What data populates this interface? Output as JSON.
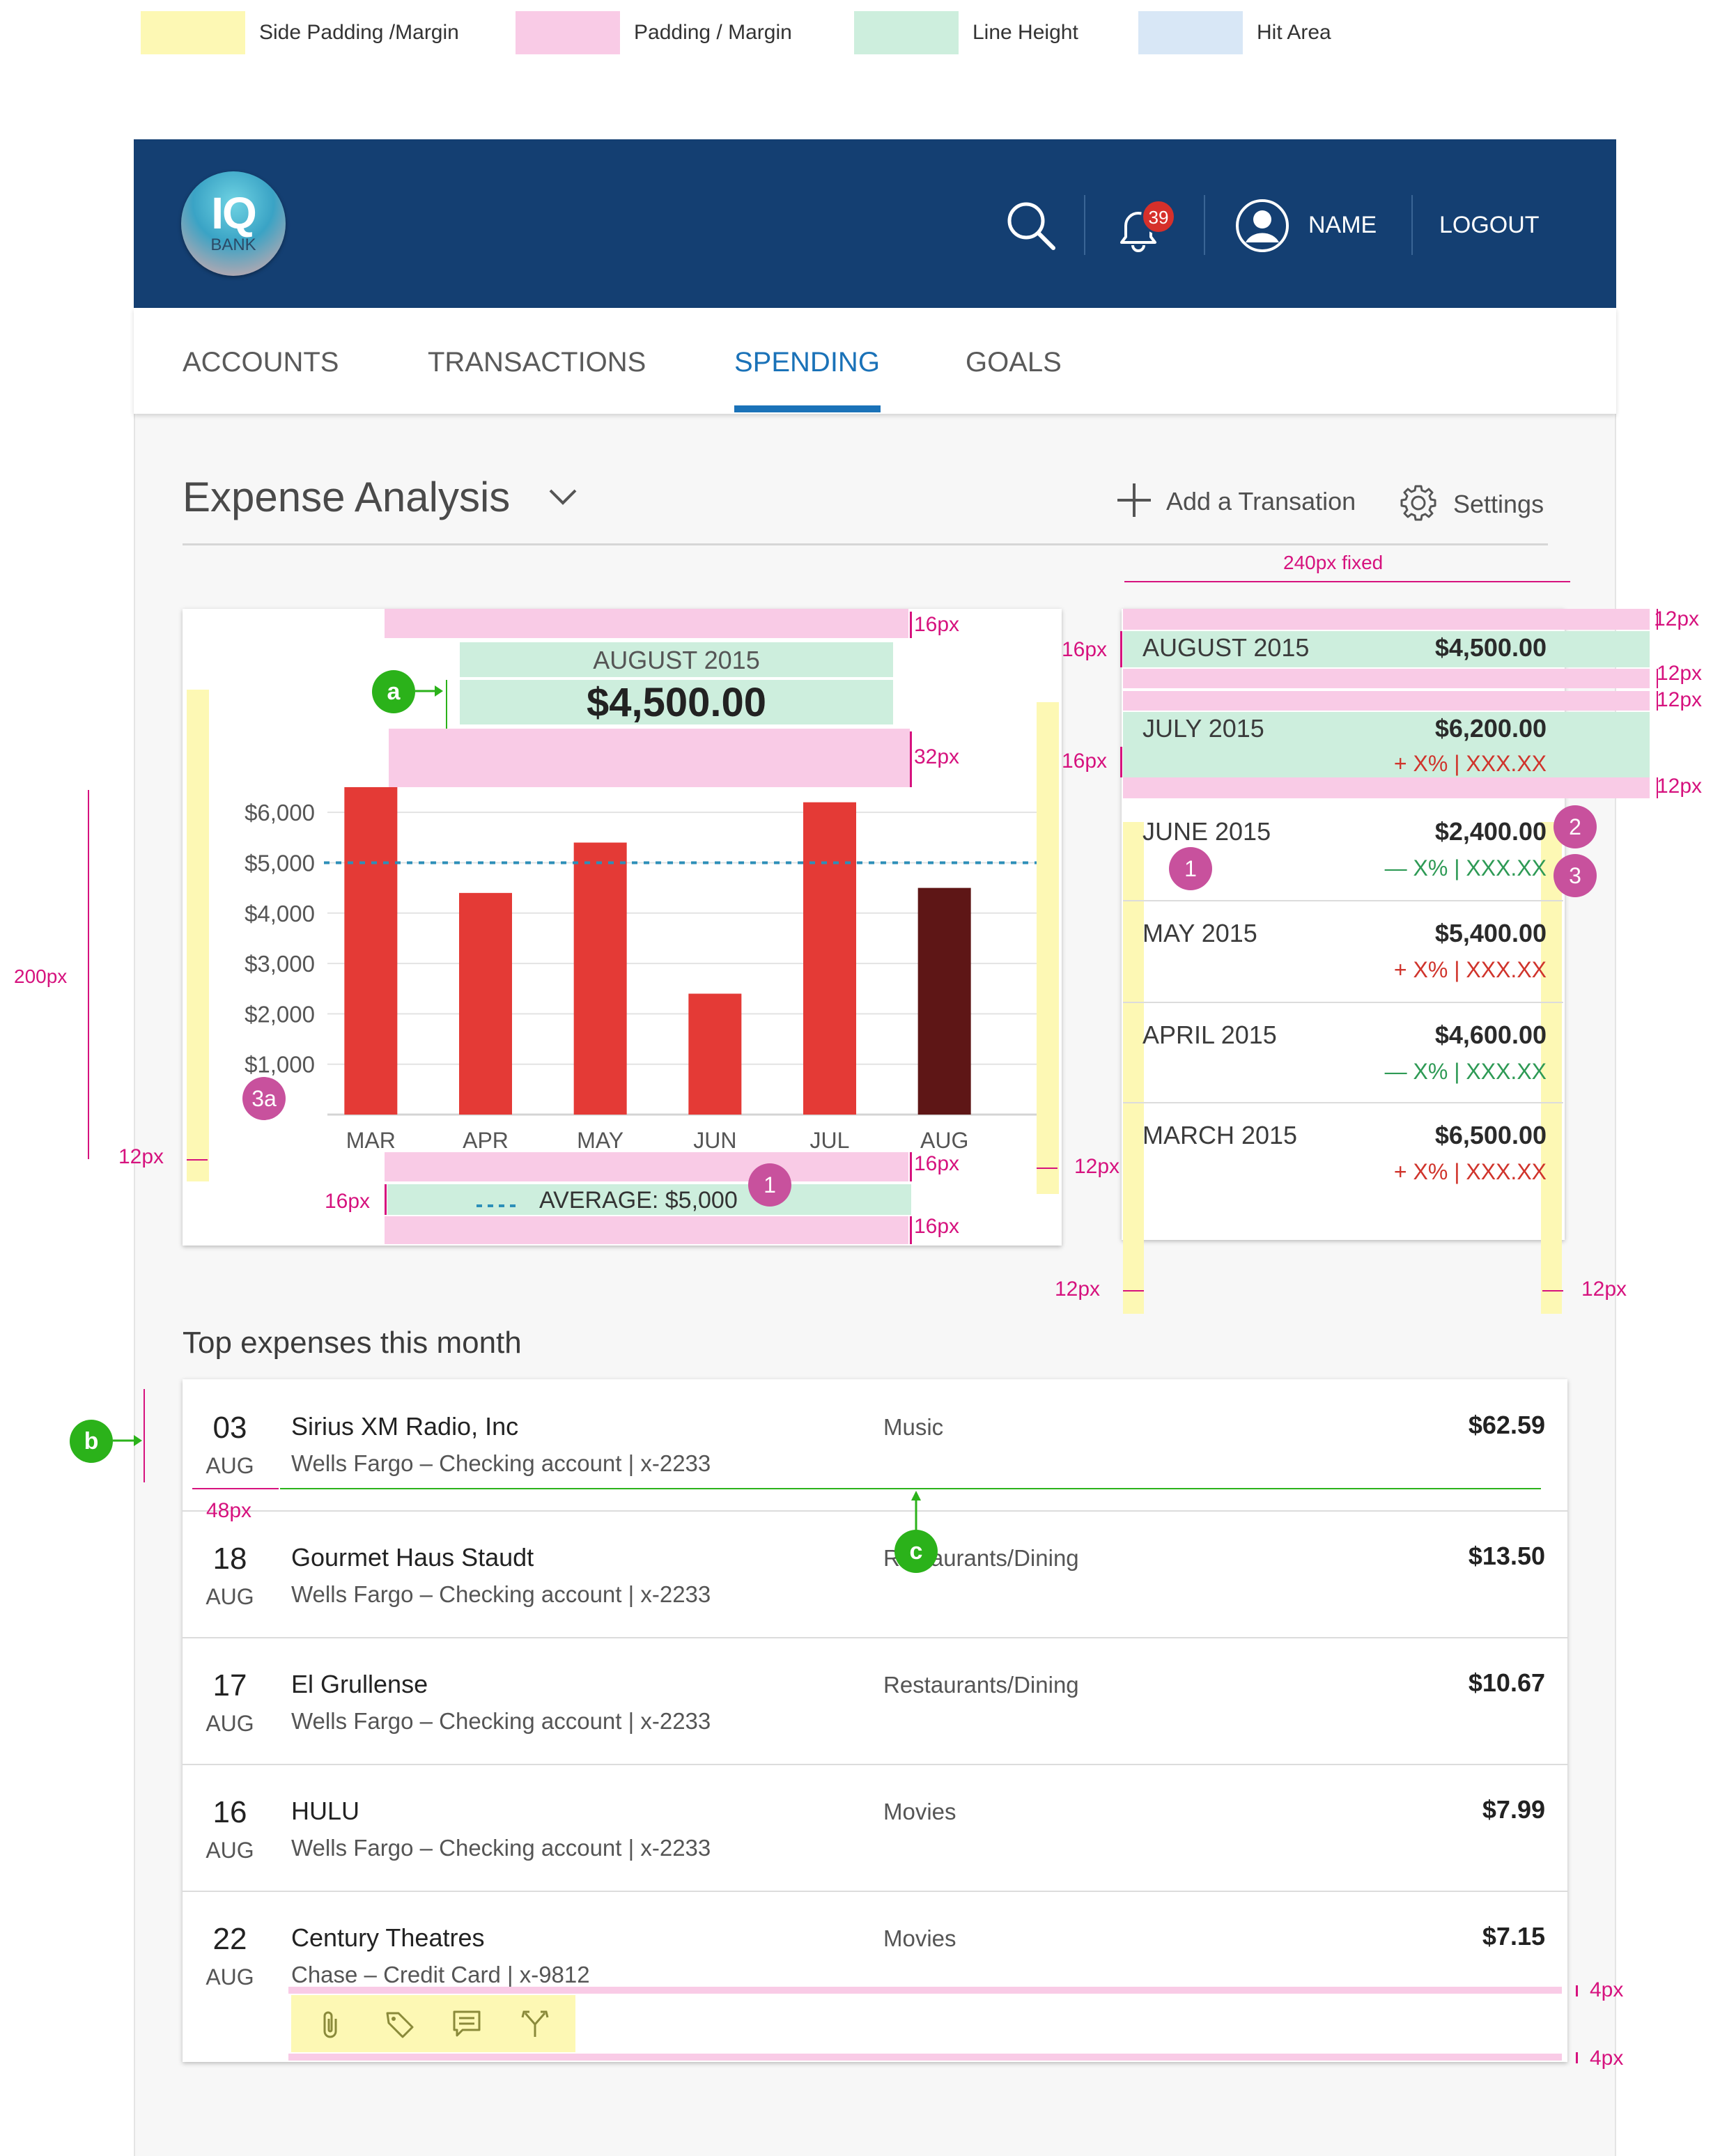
{
  "legend": [
    {
      "label": "Side Padding /Margin",
      "color": "#fdf8b4"
    },
    {
      "label": "Padding / Margin",
      "color": "#f9cbe6"
    },
    {
      "label": "Line Height",
      "color": "#cdeedd"
    },
    {
      "label": "Hit Area",
      "color": "#d8e7f6"
    }
  ],
  "header": {
    "logo_main": "IQ",
    "logo_sub": "BANK",
    "notification_count": "39",
    "user_name": "NAME",
    "logout": "LOGOUT"
  },
  "nav": {
    "tabs": [
      {
        "label": "ACCOUNTS"
      },
      {
        "label": "TRANSACTIONS"
      },
      {
        "label": "SPENDING",
        "active": true
      },
      {
        "label": "GOALS"
      }
    ]
  },
  "page": {
    "title": "Expense Analysis",
    "add_label": "Add a Transation",
    "settings_label": "Settings"
  },
  "chart_data": {
    "type": "bar",
    "header_month": "AUGUST 2015",
    "header_amount": "$4,500.00",
    "categories": [
      "MAR",
      "APR",
      "MAY",
      "JUN",
      "JUL",
      "AUG"
    ],
    "values": [
      6500,
      4400,
      5400,
      2400,
      6200,
      4500
    ],
    "highlight_index": 5,
    "colors": {
      "bar": "#e43a36",
      "highlight": "#5e1616",
      "average": "#2d8fb8"
    },
    "ylim": [
      0,
      6500
    ],
    "yticks": [
      1000,
      2000,
      3000,
      4000,
      5000,
      6000
    ],
    "ytick_labels": [
      "$1,000",
      "$2,000",
      "$3,000",
      "$4,000",
      "$5,000",
      "$6,000"
    ],
    "average": 5000,
    "average_label": "AVERAGE: $5,000",
    "grid": true
  },
  "months": [
    {
      "label": "AUGUST 2015",
      "amount": "$4,500.00",
      "change": ""
    },
    {
      "label": "JULY 2015",
      "amount": "$6,200.00",
      "sign": "+",
      "change": "X%  |  XXX.XX"
    },
    {
      "label": "JUNE 2015",
      "amount": "$2,400.00",
      "sign": "—",
      "change": "X%  |  XXX.XX"
    },
    {
      "label": "MAY 2015",
      "amount": "$5,400.00",
      "sign": "+",
      "change": "X%  |  XXX.XX"
    },
    {
      "label": "APRIL 2015",
      "amount": "$4,600.00",
      "sign": "—",
      "change": "X%  |  XXX.XX"
    },
    {
      "label": "MARCH 2015",
      "amount": "$6,500.00",
      "sign": "+",
      "change": "X%  |  XXX.XX"
    }
  ],
  "top_expenses": {
    "title": "Top expenses this month",
    "items": [
      {
        "day": "03",
        "month": "AUG",
        "name": "Sirius XM Radio, Inc",
        "account": "Wells Fargo – Checking account | x-2233",
        "category": "Music",
        "amount": "$62.59"
      },
      {
        "day": "18",
        "month": "AUG",
        "name": "Gourmet Haus Staudt",
        "account": "Wells Fargo – Checking account | x-2233",
        "category": "Restaurants/Dining",
        "amount": "$13.50"
      },
      {
        "day": "17",
        "month": "AUG",
        "name": "El Grullense",
        "account": "Wells Fargo – Checking account | x-2233",
        "category": "Restaurants/Dining",
        "amount": "$10.67"
      },
      {
        "day": "16",
        "month": "AUG",
        "name": "HULU",
        "account": "Wells Fargo – Checking account | x-2233",
        "category": "Movies",
        "amount": "$7.99"
      },
      {
        "day": "22",
        "month": "AUG",
        "name": "Century Theatres",
        "account": "Chase – Credit Card | x-9812",
        "category": "Movies",
        "amount": "$7.15"
      }
    ]
  },
  "annotations": {
    "fixed_width": "240px fixed",
    "p16": "16px",
    "p32": "32px",
    "p12": "12px",
    "p200": "200px",
    "p48": "48px",
    "p4": "4px",
    "marker_1": "1",
    "marker_2": "2",
    "marker_3": "3",
    "marker_3a": "3a",
    "marker_a": "a",
    "marker_b": "b",
    "marker_c": "c"
  }
}
